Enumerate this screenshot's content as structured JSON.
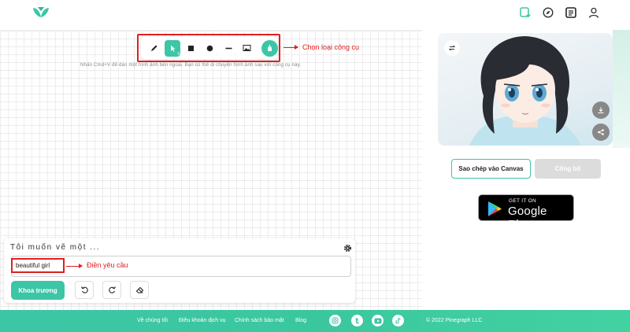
{
  "header": {
    "icons": [
      "logo-icon",
      "new-canvas-icon",
      "explore-icon",
      "gallery-icon",
      "user-icon"
    ]
  },
  "toolbar": {
    "tools": [
      {
        "name": "pencil-tool",
        "sub": ""
      },
      {
        "name": "select-tool",
        "sub": "S"
      },
      {
        "name": "rectangle-tool",
        "sub": ""
      },
      {
        "name": "circle-tool",
        "sub": "."
      },
      {
        "name": "line-tool",
        "sub": "."
      },
      {
        "name": "image-tool",
        "sub": ""
      },
      {
        "name": "fill-tool",
        "sub": ""
      }
    ],
    "annotation": "Chọn loại công cụ"
  },
  "canvas": {
    "hint": "Nhấn Cmd+V để dán một hình ảnh bên ngoài. Bạn có thể di chuyển hình ảnh sau với công cụ này."
  },
  "prompt": {
    "title": "Tôi muốn vẽ một ...",
    "input_value": "beautiful girl",
    "annotation": "Điền yêu cầu",
    "submit_label": "Khoa trương"
  },
  "preview": {
    "copy_label": "Sao chép vào Canvas",
    "publish_label": "Công bố"
  },
  "store": {
    "small": "GET IT ON",
    "big": "Google Play"
  },
  "footer": {
    "links": [
      "Về chúng tôi",
      "Điều khoản dịch vụ",
      "Chính sách bảo mật",
      "Blog"
    ],
    "copyright": "© 2022 Pinegraph LLC"
  },
  "colors": {
    "accent": "#3cc6a6",
    "annotation": "#e02020"
  }
}
